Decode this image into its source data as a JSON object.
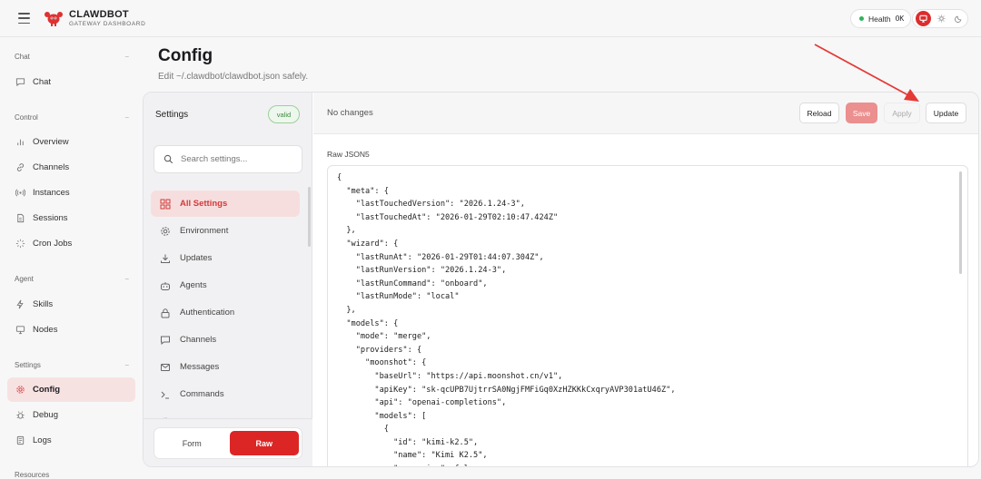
{
  "header": {
    "brand_title": "CLAWDBOT",
    "brand_subtitle": "GATEWAY DASHBOARD",
    "health_label": "Health",
    "health_value": "OK"
  },
  "sidebar": {
    "groups": [
      {
        "label": "Chat",
        "items": [
          {
            "label": "Chat",
            "icon": "chat-icon"
          }
        ]
      },
      {
        "label": "Control",
        "items": [
          {
            "label": "Overview",
            "icon": "bar-chart-icon"
          },
          {
            "label": "Channels",
            "icon": "link-icon"
          },
          {
            "label": "Instances",
            "icon": "radio-icon"
          },
          {
            "label": "Sessions",
            "icon": "document-icon"
          },
          {
            "label": "Cron Jobs",
            "icon": "loader-icon"
          }
        ]
      },
      {
        "label": "Agent",
        "items": [
          {
            "label": "Skills",
            "icon": "zap-icon"
          },
          {
            "label": "Nodes",
            "icon": "monitor-icon"
          }
        ]
      },
      {
        "label": "Settings",
        "items": [
          {
            "label": "Config",
            "icon": "gear-icon",
            "active": true
          },
          {
            "label": "Debug",
            "icon": "bug-icon"
          },
          {
            "label": "Logs",
            "icon": "file-text-icon"
          }
        ]
      },
      {
        "label": "Resources",
        "items": []
      }
    ]
  },
  "page": {
    "title": "Config",
    "subtitle": "Edit ~/.clawdbot/clawdbot.json safely."
  },
  "settings_panel": {
    "title": "Settings",
    "status_badge": "valid",
    "search_placeholder": "Search settings...",
    "categories": [
      {
        "label": "All Settings",
        "icon": "grid-icon",
        "active": true
      },
      {
        "label": "Environment",
        "icon": "gear-icon"
      },
      {
        "label": "Updates",
        "icon": "download-icon"
      },
      {
        "label": "Agents",
        "icon": "bot-icon"
      },
      {
        "label": "Authentication",
        "icon": "lock-icon"
      },
      {
        "label": "Channels",
        "icon": "chat-icon"
      },
      {
        "label": "Messages",
        "icon": "mail-icon"
      },
      {
        "label": "Commands",
        "icon": "terminal-icon"
      }
    ],
    "mode_toggle": {
      "form_label": "Form",
      "raw_label": "Raw",
      "selected": "Raw"
    }
  },
  "actionbar": {
    "status": "No changes",
    "reload_label": "Reload",
    "save_label": "Save",
    "apply_label": "Apply",
    "update_label": "Update"
  },
  "editor": {
    "label": "Raw JSON5",
    "content": "{\n  \"meta\": {\n    \"lastTouchedVersion\": \"2026.1.24-3\",\n    \"lastTouchedAt\": \"2026-01-29T02:10:47.424Z\"\n  },\n  \"wizard\": {\n    \"lastRunAt\": \"2026-01-29T01:44:07.304Z\",\n    \"lastRunVersion\": \"2026.1.24-3\",\n    \"lastRunCommand\": \"onboard\",\n    \"lastRunMode\": \"local\"\n  },\n  \"models\": {\n    \"mode\": \"merge\",\n    \"providers\": {\n      \"moonshot\": {\n        \"baseUrl\": \"https://api.moonshot.cn/v1\",\n        \"apiKey\": \"sk-qcUPB7UjtrrSA0NgjFMFiGq0XzHZKKkCxqryAVP301atU46Z\",\n        \"api\": \"openai-completions\",\n        \"models\": [\n          {\n            \"id\": \"kimi-k2.5\",\n            \"name\": \"Kimi K2.5\",\n            \"reasoning\": false,"
  },
  "colors": {
    "accent": "#dc2626",
    "active_bg": "#f7e2e2",
    "health_dot": "#2fb35a",
    "annotation_arrow": "#e53935"
  }
}
